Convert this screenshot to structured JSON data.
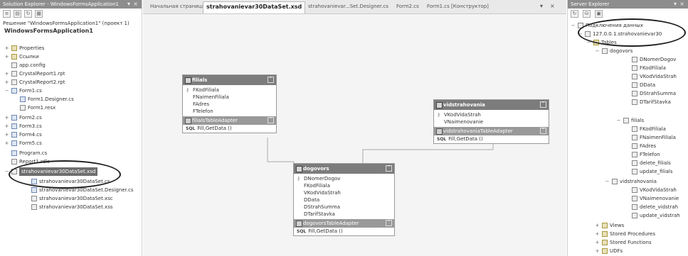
{
  "solution_explorer": {
    "title": "Solution Explorer - WindowsFormsApplication1",
    "root_label": "Решение \"WindowsFormsApplication1\" (проект 1)",
    "project_label": "WindowsFormsApplication1",
    "items": [
      {
        "label": "Properties"
      },
      {
        "label": "Ссылки"
      },
      {
        "label": "app.config"
      },
      {
        "label": "CrystalReport1.rpt"
      },
      {
        "label": "CrystalReport2.rpt"
      },
      {
        "label": "Form1.cs"
      },
      {
        "label": "Form1.Designer.cs"
      },
      {
        "label": "Form1.resx"
      },
      {
        "label": "Form2.cs"
      },
      {
        "label": "Form3.cs"
      },
      {
        "label": "Form4.cs"
      },
      {
        "label": "Form5.cs"
      },
      {
        "label": "Program.cs"
      },
      {
        "label": "Report1.rdlc"
      },
      {
        "label": "strahovanievar30DataSet.xsd"
      },
      {
        "label": "strahovanievar30DataSet.cs"
      },
      {
        "label": "strahovanievar30DataSet.Designer.cs"
      },
      {
        "label": "strahovanievar30DataSet.xsc"
      },
      {
        "label": "strahovanievar30DataSet.xss"
      }
    ]
  },
  "editor": {
    "tabs": [
      {
        "label": "Начальная страница"
      },
      {
        "label": "strahovanievar30DataSet.xsd"
      },
      {
        "label": "strahovanievar...Set.Designer.cs"
      },
      {
        "label": "Form2.cs"
      },
      {
        "label": "Form1.cs [Конструктор]"
      }
    ],
    "tables": {
      "filials": {
        "name": "filials",
        "columns": [
          "FKodFiliala",
          "FNaimenFiliala",
          "FAdres",
          "FTelefon"
        ],
        "adapter": "filialsTableAdapter",
        "methods": [
          "Fill,GetData ()"
        ]
      },
      "vidstrahovania": {
        "name": "vidstrahovania",
        "columns": [
          "VKodVidaStrah",
          "VNaimenovanie"
        ],
        "adapter": "vidstrahovaniaTableAdapter",
        "methods": [
          "Fill,GetData ()"
        ]
      },
      "dogovors": {
        "name": "dogovors",
        "columns": [
          "DNomerDogov",
          "FKodFiliala",
          "VKodVidaStrah",
          "DData",
          "DStrahSumma",
          "DTarifStavka"
        ],
        "adapter": "dogovorsTableAdapter",
        "methods": [
          "Fill,GetData ()"
        ]
      }
    }
  },
  "server_explorer": {
    "title": "Server Explorer",
    "data_connections": "Подключения данных",
    "server": "127.0.0.1.strahovanievar30",
    "tables_label": "Tables",
    "tables": [
      {
        "name": "dogovors",
        "columns": [
          "DNomerDogov",
          "FKodFiliala",
          "VKodVidaStrah",
          "DData",
          "DStrahSumma",
          "DTarifStavka"
        ]
      },
      {
        "name": "filials",
        "columns": [
          "FKodFiliala",
          "FNaimenFiliala",
          "FAdres",
          "FTelefon",
          "delete_filials",
          "update_filials"
        ]
      },
      {
        "name": "vidstrahovania",
        "columns": [
          "VKodVidaStrah",
          "VNaimenovanie",
          "delete_vidstrah",
          "update_vidstrah"
        ]
      }
    ],
    "nodes": [
      {
        "label": "Views"
      },
      {
        "label": "Stored Procedures"
      },
      {
        "label": "Stored Functions"
      },
      {
        "label": "UDFs"
      }
    ]
  }
}
